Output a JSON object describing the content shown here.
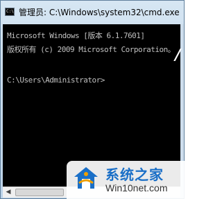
{
  "window": {
    "title": "管理员: C:\\Windows\\system32\\cmd.exe",
    "icon": "cmd-icon",
    "icon_label": "C:\\."
  },
  "console": {
    "lines": [
      "Microsoft Windows [版本 6.1.7601]",
      "版权所有 (c) 2009 Microsoft Corporation。",
      "C:\\Users\\Administrator>"
    ]
  },
  "scrollbar": {
    "left_arrow": "◀"
  },
  "watermark": {
    "title": "系统之家",
    "url": "Win10net.com",
    "logo_colors": [
      "#1a6fc7",
      "#f0a000"
    ]
  },
  "overlay": {
    "glyph": "/"
  }
}
